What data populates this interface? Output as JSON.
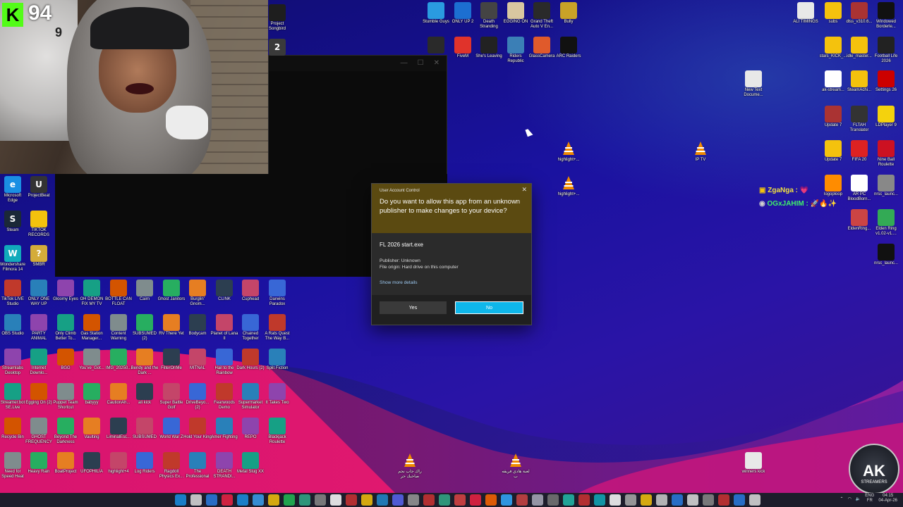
{
  "stream": {
    "badge_letter": "K",
    "viewer_count": "94"
  },
  "uac": {
    "title": "User Account Control",
    "question": "Do you want to allow this app from an unknown publisher to make changes to your device?",
    "app_name": "FL 2026 start.exe",
    "publisher": "Publisher: Unknown",
    "origin": "File origin: Hard drive on this computer",
    "more_details": "Show more details",
    "yes_label": "Yes",
    "no_label": "No"
  },
  "chat": [
    {
      "name": "ZgaNga :",
      "color": "#f0e040",
      "emotes": "💗"
    },
    {
      "name": "OGxJAHIM :",
      "color": "#3ff06a",
      "emotes": "🚀🔥✨"
    }
  ],
  "logo": {
    "big": "AK",
    "small": "STREAMERS"
  },
  "clock": {
    "lang_top": "ENG",
    "lang_bottom": "FR",
    "time": "04:15",
    "date": "04-Apr-26"
  },
  "icons": {
    "col_left": [
      {
        "label": "Microsoft Edge",
        "color": "#1a8fe3",
        "glyph": "e"
      },
      {
        "label": "ProjectBeat",
        "color": "#333",
        "glyph": "U"
      },
      {
        "label": "Steam",
        "color": "#1b2838",
        "glyph": "S"
      },
      {
        "label": "TIKTOK RECORDS",
        "color": "#f4c20d",
        "glyph": ""
      },
      {
        "label": "Wondershare Filmora 14",
        "color": "#1ab",
        "glyph": "W"
      },
      {
        "label": "SMBR",
        "color": "#d4ac3a",
        "glyph": "?"
      }
    ],
    "grid": [
      [
        "TikTok LIVE Studio",
        "ONLY ONE WAY UP",
        "Gloomy Eyes",
        "OH DEMON FIX MY TV",
        "BOTTLE CAN FLOAT",
        "Cairn",
        "Ghost Janitors",
        "Burglin' Gnom...",
        "CLINK",
        "Cuphead",
        "Darwins Paradox"
      ],
      [
        "OBS Studio",
        "PARTY ANIMAL",
        "Only Climb Better To...",
        "Gas Station Manager...",
        "Content Warning",
        "SUBSUMED (2)",
        "RV There Yet",
        "Bodycam",
        "Planet of Lana II",
        "Chained Together",
        "A Rats Quest The Way B..."
      ],
      [
        "Streamlabs Desktop",
        "Internet Downlo...",
        "BGG",
        "You've_Got...",
        "IMG_20250...",
        "Bendy and the Dark ...",
        "FilterOnMe",
        "MITNAL",
        "Hail to the Rainbow",
        "Dark Hours (2)",
        "Split Fiction"
      ],
      [
        "Streamer.bot SE.Live",
        "Egging On (2)",
        "Puppet Team Shortcut",
        "babyyy",
        "CautionAh...",
        "ali kick",
        "Super Battle Golf",
        "DriveBeyo... (2)",
        "Fearwoods Demo",
        "Supermarket Simulator",
        "It Takes Two"
      ],
      [
        "Recycle Bin",
        "GHOST FREQUENCY",
        "Beyond The Darkness",
        "Vaulting",
        "LiminalEsc...",
        "SUBSUMED",
        "World War Z",
        "Hold Your King",
        "Amer Fighting",
        "REPO",
        "Blackjack Roulette"
      ],
      [
        "Need for Speed Heat",
        "Heavy Rain",
        "BoatProject",
        "UFOPHILIA",
        "highlight+4",
        "Log Riders",
        "Ragdoll Physics Ex...",
        "The Professional",
        "DEATH STRANDI...",
        "Metal Slug XX",
        ""
      ]
    ],
    "top_middle": [
      {
        "label": "Stumble Guys",
        "color": "#2a9be0"
      },
      {
        "label": "ONLY UP 2",
        "color": "#1c6fd1"
      },
      {
        "label": "Death Stranding",
        "color": "#444"
      },
      {
        "label": "EGGING ON",
        "color": "#d9c7a0"
      },
      {
        "label": "Grand Theft Auto V En...",
        "color": "#2a2a2a"
      },
      {
        "label": "Bully",
        "color": "#c9a227"
      },
      {
        "label": "",
        "color": "#2a2a2a"
      },
      {
        "label": "FiveM",
        "color": "#e0332b"
      },
      {
        "label": "She's Leaving",
        "color": "#222"
      },
      {
        "label": "Riders Republic",
        "color": "#3b7fb6"
      },
      {
        "label": "GlassCamera",
        "color": "#e05a2b"
      },
      {
        "label": "ARC Raiders",
        "color": "#111"
      }
    ],
    "project_songbird": "Project Songbird",
    "right": [
      {
        "label": "ALI TIMINGS",
        "color": "#e8e8e8"
      },
      {
        "label": "subs",
        "color": "#f4c20d"
      },
      {
        "label": "dlss_v310.6...",
        "color": "#a33"
      },
      {
        "label": "Windowed Borderle...",
        "color": "#111"
      },
      {
        "label": "stars_KICK_...",
        "color": "#f4c20d"
      },
      {
        "label": "idle_master...",
        "color": "#f4c20d"
      },
      {
        "label": "Football Life 2026",
        "color": "#222"
      },
      {
        "label": "New Text Docume...",
        "color": "#e8e8e8"
      },
      {
        "label": "ak-stream...",
        "color": "#fff"
      },
      {
        "label": "SteamAchi...",
        "color": "#f4c20d"
      },
      {
        "label": "Settings 26",
        "color": "#c00"
      },
      {
        "label": "Update 7",
        "color": "#a33"
      },
      {
        "label": "FLTAH Translator",
        "color": "#333"
      },
      {
        "label": "LDPlayer 9",
        "color": "#f4d20d"
      },
      {
        "label": "Update 7",
        "color": "#f4c20d"
      },
      {
        "label": "FIFA 20",
        "color": "#d22"
      },
      {
        "label": "Nine Ball Roulette",
        "color": "#c12"
      },
      {
        "label": "logoploop",
        "color": "#ff8c00"
      },
      {
        "label": "AR PC BloodBorn...",
        "color": "#fff"
      },
      {
        "label": "nrsc_launc...",
        "color": "#888"
      },
      {
        "label": "EldenRing...",
        "color": "#c44"
      },
      {
        "label": "Elden Ring v1.02-v1....",
        "color": "#3a5"
      },
      {
        "label": "nrsc_launc...",
        "color": "#111"
      }
    ],
    "vlc": [
      {
        "label": "highlight+..."
      },
      {
        "label": "highlight+..."
      },
      {
        "label": "IP TV"
      },
      {
        "label": "راك جاب نجم صاحبك حر"
      },
      {
        "label": "لعبة هادي فريقه ب"
      }
    ],
    "winners_kick": "winners kick"
  }
}
